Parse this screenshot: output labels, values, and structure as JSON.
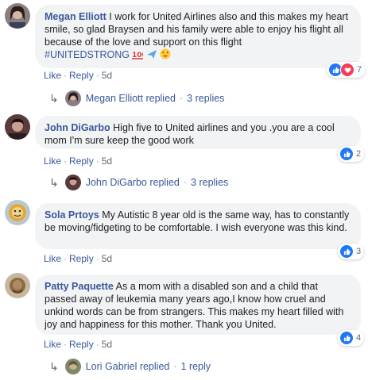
{
  "comments": [
    {
      "author": "Megan Elliott",
      "text": "I work for United Airlines also and this makes my heart smile, so glad Braysen and his family were able to enjoy his flight all because of the love and support on this flight",
      "hashtag": "#UNITEDSTRONG",
      "reaction_count": "7",
      "like": "Like",
      "reply": "Reply",
      "time": "5d",
      "replies_author": "Megan Elliott replied",
      "replies_count": "3 replies"
    },
    {
      "author": "John DiGarbo",
      "text": "High five to United airlines and you .you are a cool mom I'm sure keep the good work",
      "reaction_count": "2",
      "like": "Like",
      "reply": "Reply",
      "time": "5d",
      "replies_author": "John DiGarbo replied",
      "replies_count": "3 replies"
    },
    {
      "author": "Sola Prtoys",
      "text": "My Autistic 8 year old is the same way, has to constantly be moving/fidgeting to be comfortable. I wish everyone was this kind.",
      "reaction_count": "3",
      "like": "Like",
      "reply": "Reply",
      "time": "5d"
    },
    {
      "author": "Patty Paquette",
      "text": "As a mom with a disabled son and a child that passed away of leukemia many years ago,I know how cruel and unkind words can be from strangers. This makes my heart filled with joy and happiness for this mother. Thank you United.",
      "reaction_count": "4",
      "like": "Like",
      "reply": "Reply",
      "time": "5d",
      "replies_author": "Lori Gabriel replied",
      "replies_count": "1 reply"
    }
  ],
  "colors": {
    "link": "#385898",
    "bubble": "#f2f3f5",
    "like": "#2078f4",
    "love": "#f33e58"
  }
}
